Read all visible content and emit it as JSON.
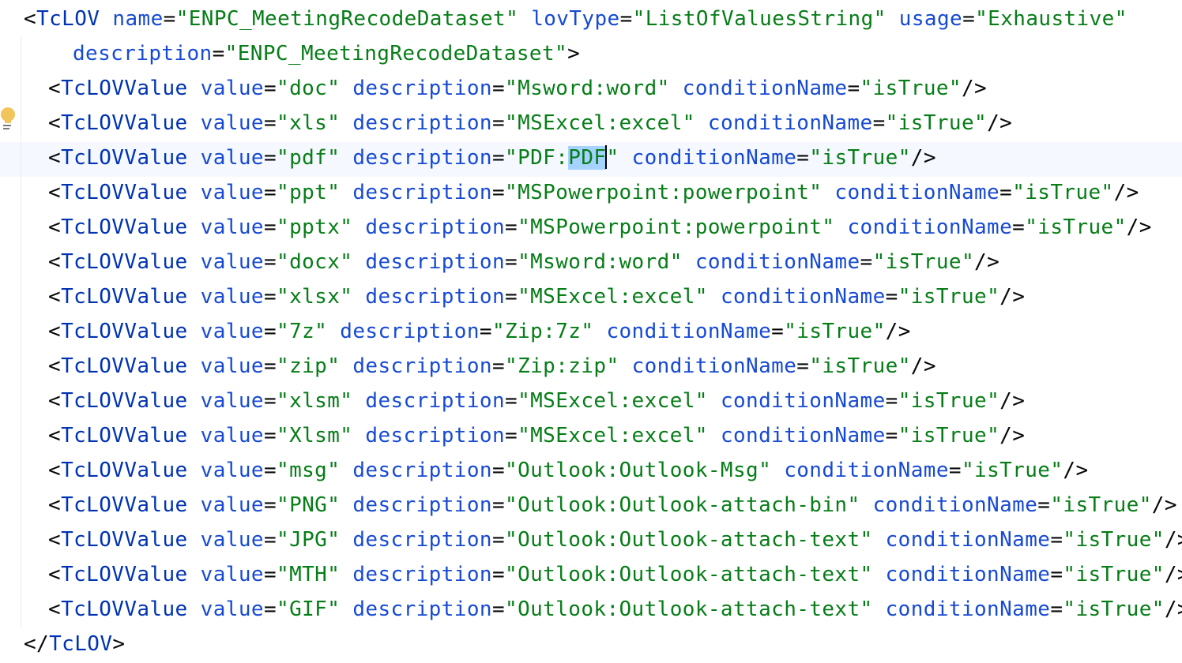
{
  "root": {
    "open_bracket": "<",
    "tag": "TcLOV",
    "attributes": [
      {
        "name": "name",
        "value": "\"ENPC_MeetingRecodeDataset\""
      },
      {
        "name": "lovType",
        "value": "\"ListOfValuesString\""
      },
      {
        "name": "usage",
        "value": "\"Exhaustive\""
      }
    ],
    "description_attr": {
      "name": "description",
      "value": "\"ENPC_MeetingRecodeDataset\""
    },
    "close_open": ">",
    "closing_tag": {
      "open": "</",
      "tag": "TcLOV",
      "close": ">"
    }
  },
  "syntax": {
    "open": "<",
    "self_close": "/>",
    "equals": "="
  },
  "children": [
    {
      "tag": "TcLOVValue",
      "value": "\"doc\"",
      "description": "\"Msword:word\"",
      "condition": "\"isTrue\""
    },
    {
      "tag": "TcLOVValue",
      "value": "\"xls\"",
      "description": "\"MSExcel:excel\"",
      "condition": "\"isTrue\""
    },
    {
      "tag": "TcLOVValue",
      "value": "\"pdf\"",
      "description": "\"PDF:PDF\"",
      "condition": "\"isTrue\""
    },
    {
      "tag": "TcLOVValue",
      "value": "\"ppt\"",
      "description": "\"MSPowerpoint:powerpoint\"",
      "condition": "\"isTrue\""
    },
    {
      "tag": "TcLOVValue",
      "value": "\"pptx\"",
      "description": "\"MSPowerpoint:powerpoint\"",
      "condition": "\"isTrue\""
    },
    {
      "tag": "TcLOVValue",
      "value": "\"docx\"",
      "description": "\"Msword:word\"",
      "condition": "\"isTrue\""
    },
    {
      "tag": "TcLOVValue",
      "value": "\"xlsx\"",
      "description": "\"MSExcel:excel\"",
      "condition": "\"isTrue\""
    },
    {
      "tag": "TcLOVValue",
      "value": "\"7z\"",
      "description": "\"Zip:7z\"",
      "condition": "\"isTrue\""
    },
    {
      "tag": "TcLOVValue",
      "value": "\"zip\"",
      "description": "\"Zip:zip\"",
      "condition": "\"isTrue\""
    },
    {
      "tag": "TcLOVValue",
      "value": "\"xlsm\"",
      "description": "\"MSExcel:excel\"",
      "condition": "\"isTrue\""
    },
    {
      "tag": "TcLOVValue",
      "value": "\"Xlsm\"",
      "description": "\"MSExcel:excel\"",
      "condition": "\"isTrue\""
    },
    {
      "tag": "TcLOVValue",
      "value": "\"msg\"",
      "description": "\"Outlook:Outlook-Msg\"",
      "condition": "\"isTrue\""
    },
    {
      "tag": "TcLOVValue",
      "value": "\"PNG\"",
      "description": "\"Outlook:Outlook-attach-bin\"",
      "condition": "\"isTrue\""
    },
    {
      "tag": "TcLOVValue",
      "value": "\"JPG\"",
      "description": "\"Outlook:Outlook-attach-text\"",
      "condition": "\"isTrue\""
    },
    {
      "tag": "TcLOVValue",
      "value": "\"MTH\"",
      "description": "\"Outlook:Outlook-attach-text\"",
      "condition": "\"isTrue\""
    },
    {
      "tag": "TcLOVValue",
      "value": "\"GIF\"",
      "description": "\"Outlook:Outlook-attach-text\"",
      "condition": "\"isTrue\""
    }
  ],
  "attr_names": {
    "value": "value",
    "description": "description",
    "condition": "conditionName"
  },
  "selection": {
    "line": 2,
    "prefix": "\"PDF:",
    "selected": "PDF",
    "suffix": "\""
  },
  "gutter": {
    "intention_icon": "lightbulb-icon"
  },
  "colors": {
    "tag": "#0033b3",
    "attribute": "#174ad4",
    "value": "#067d17",
    "selection": "#a6d2ff",
    "current_line": "#f5f8fe"
  }
}
